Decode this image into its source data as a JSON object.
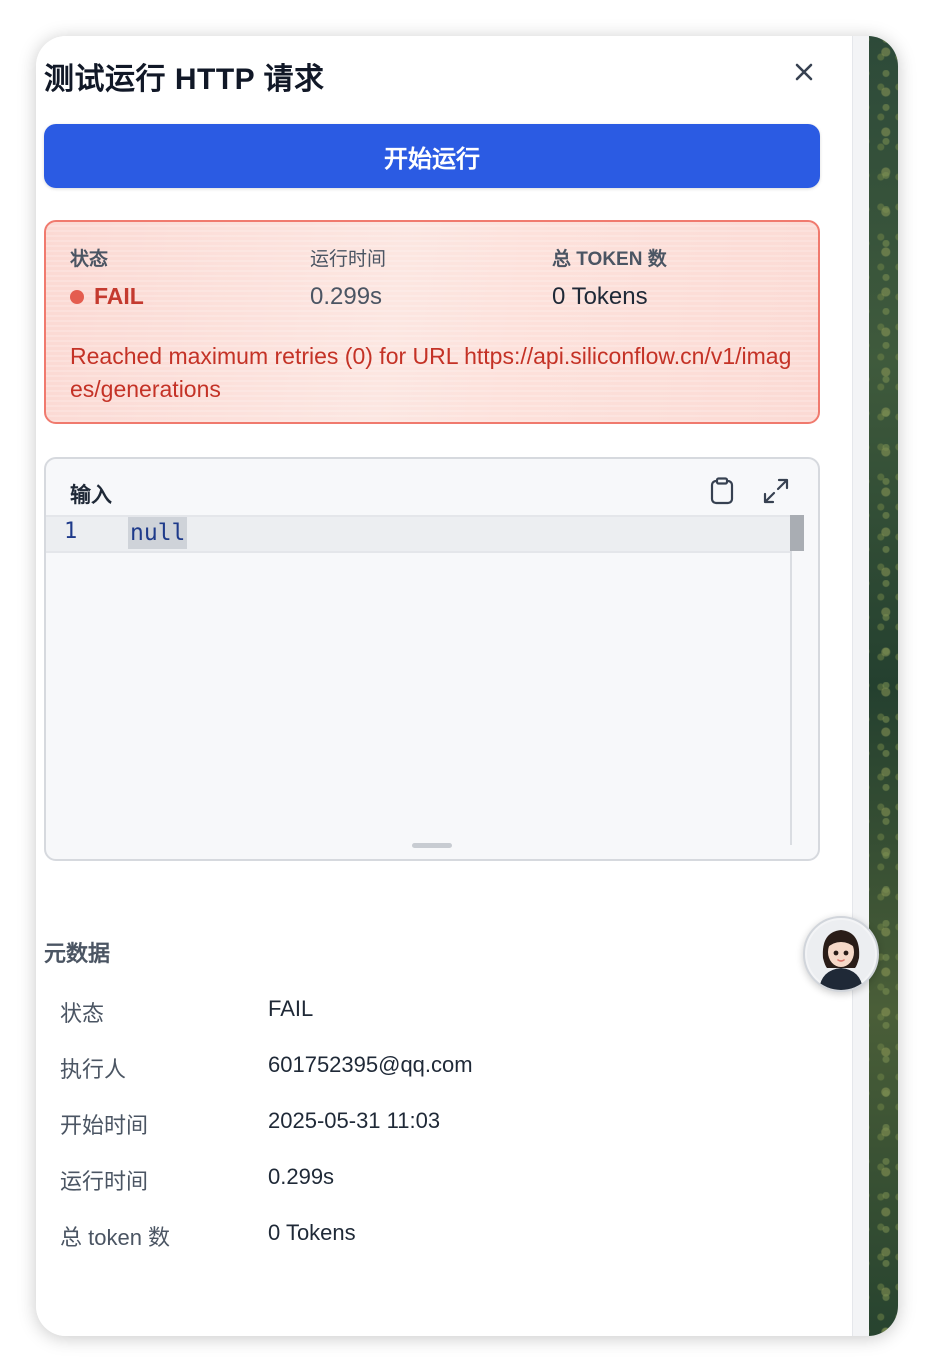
{
  "dialog": {
    "title": "测试运行 HTTP 请求",
    "run_button": "开始运行"
  },
  "result": {
    "status_label": "状态",
    "status_value": "FAIL",
    "time_label": "运行时间",
    "time_value": "0.299s",
    "tokens_label": "总 TOKEN 数",
    "tokens_value": "0 Tokens",
    "error_message": "Reached maximum retries (0) for URL https://api.siliconflow.cn/v1/images/generations"
  },
  "input": {
    "label": "输入",
    "line_number": "1",
    "code": "null"
  },
  "metadata": {
    "title": "元数据",
    "rows": [
      {
        "key": "状态",
        "value": "FAIL"
      },
      {
        "key": "执行人",
        "value": "601752395@qq.com"
      },
      {
        "key": "开始时间",
        "value": "2025-05-31 11:03"
      },
      {
        "key": "运行时间",
        "value": "0.299s"
      },
      {
        "key": "总 token 数",
        "value": "0 Tokens"
      }
    ]
  },
  "colors": {
    "primary": "#2b5be3",
    "fail": "#c43a2f",
    "fail_dot": "#e45d4f",
    "error_border": "#f07a6e"
  },
  "icons": {
    "close": "close-icon",
    "copy": "clipboard-icon",
    "expand": "expand-icon",
    "assistant": "assistant-avatar-icon"
  }
}
